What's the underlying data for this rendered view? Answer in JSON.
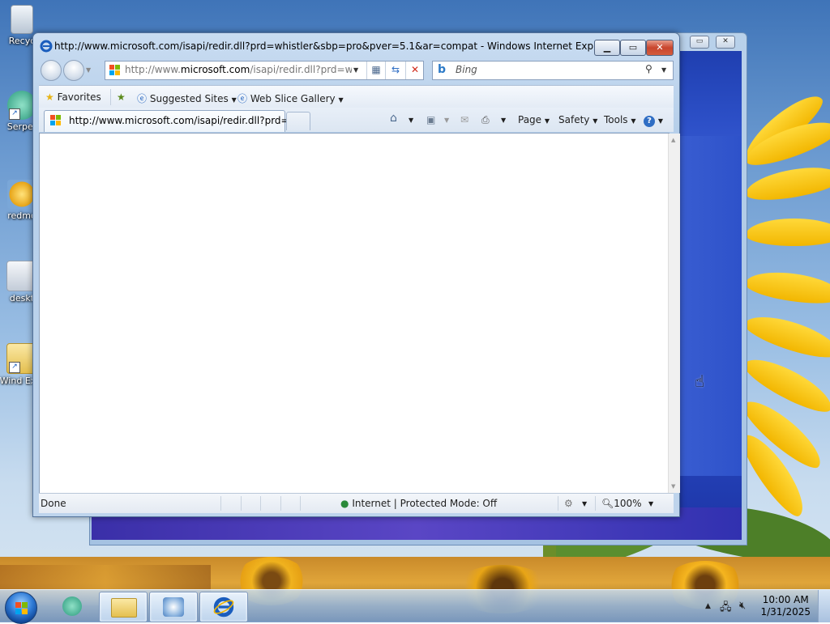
{
  "desktop": {
    "icons": [
      {
        "label": "Recyc",
        "name": "recycle-bin"
      },
      {
        "label": "Serper",
        "name": "serpent"
      },
      {
        "label": "redmo",
        "name": "redmond"
      },
      {
        "label": "deskt",
        "name": "desktop"
      },
      {
        "label": "Wind Expl",
        "name": "windows-explorer"
      }
    ]
  },
  "ie": {
    "window_title": "http://www.microsoft.com/isapi/redir.dll?prd=whistler&sbp=pro&pver=5.1&ar=compat - Windows Internet Explorer",
    "address_prefix": "http://www.",
    "address_domain": "microsoft.com",
    "address_suffix": "/isapi/redir.dll?prd=whist",
    "search_placeholder": "Bing",
    "favorites_bar": {
      "favorites_label": "Favorites",
      "suggested_sites_label": "Suggested Sites",
      "web_slice_gallery_label": "Web Slice Gallery"
    },
    "tab_title": "http://www.microsoft.com/isapi/redir.dll?prd=w...",
    "command_bar": {
      "page_label": "Page",
      "safety_label": "Safety",
      "tools_label": "Tools"
    },
    "status_bar": {
      "status_text": "Done",
      "zone_text": "Internet | Protected Mode: Off",
      "zoom_text": "100%"
    }
  },
  "taskbar": {
    "time": "10:00 AM",
    "date": "1/31/2025"
  },
  "colors": {
    "ie_blue": "#1a5dbd",
    "close_red": "#c8452d",
    "bing_blue": "#2c7ac7"
  }
}
